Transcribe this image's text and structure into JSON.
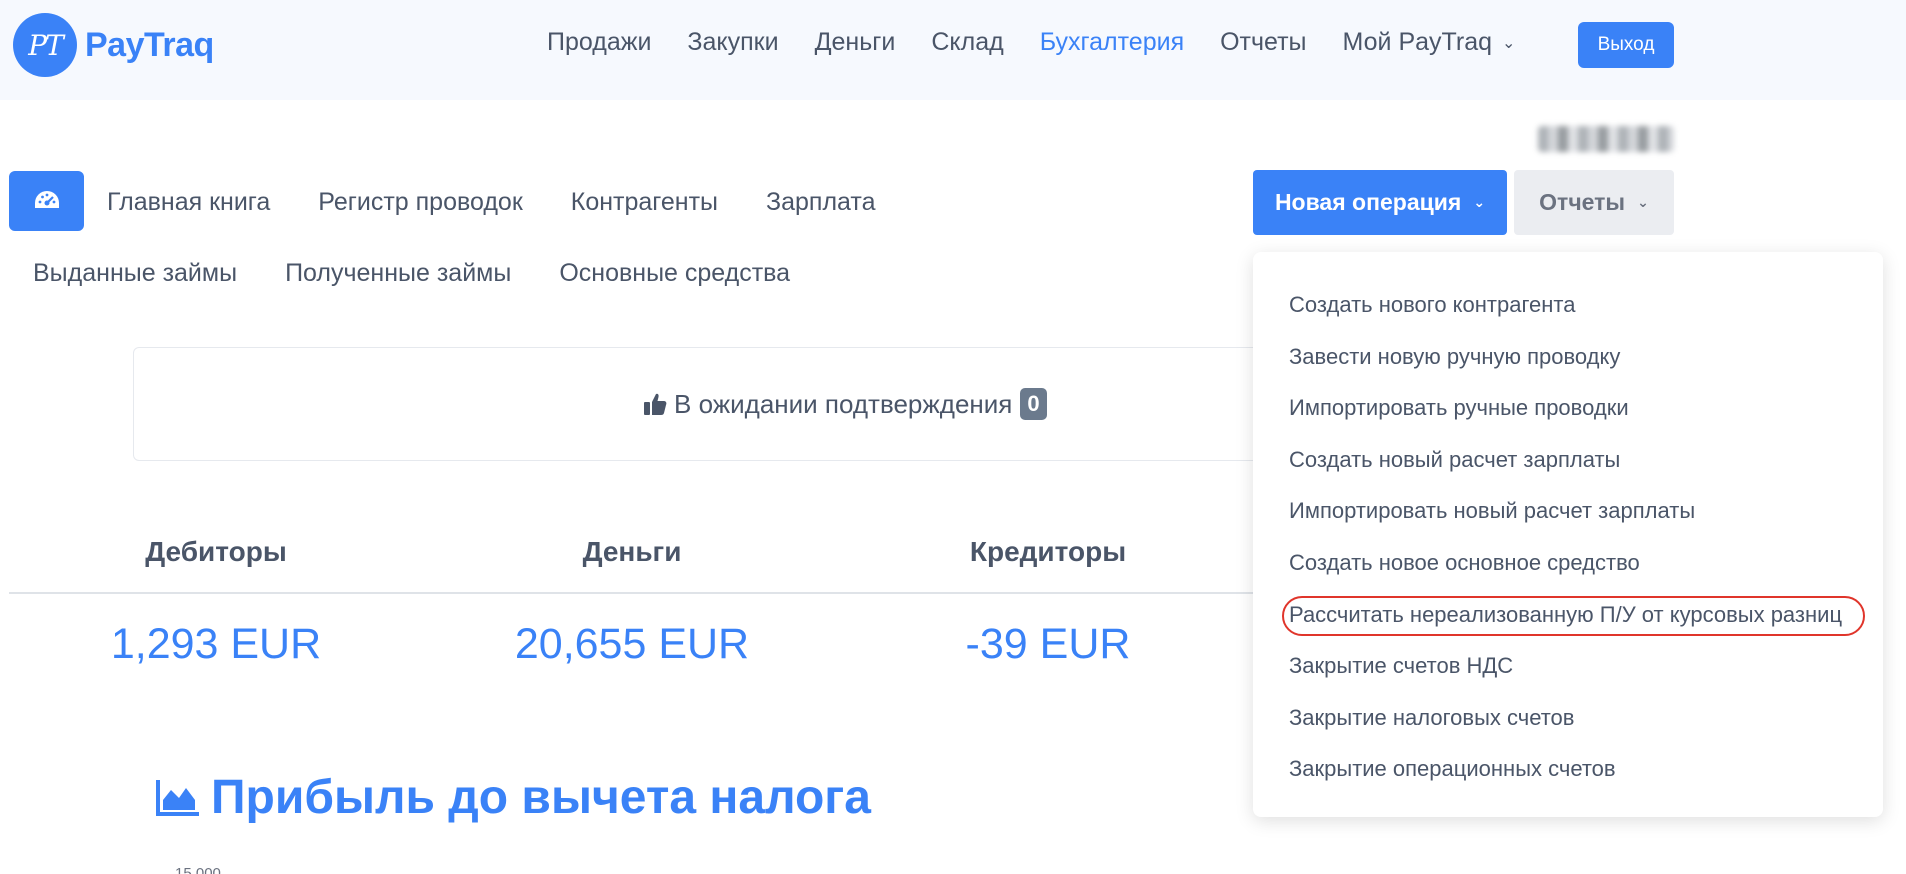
{
  "brand": {
    "name": "PayTraq",
    "logo_initials": "PT"
  },
  "main_nav": {
    "items": [
      {
        "label": "Продажи",
        "active": false
      },
      {
        "label": "Закупки",
        "active": false
      },
      {
        "label": "Деньги",
        "active": false
      },
      {
        "label": "Склад",
        "active": false
      },
      {
        "label": "Бухгалтерия",
        "active": true
      },
      {
        "label": "Отчеты",
        "active": false
      },
      {
        "label": "Мой PayTraq",
        "active": false,
        "has_dropdown": true
      }
    ],
    "logout_label": "Выход"
  },
  "sub_nav": {
    "dashboard_icon": "speedometer-icon",
    "row1": [
      "Главная книга",
      "Регистр проводок",
      "Контрагенты",
      "Зарплата"
    ],
    "row2": [
      "Выданные займы",
      "Полученные займы",
      "Основные средства"
    ]
  },
  "actions": {
    "new_operation_label": "Новая операция",
    "reports_label": "Отчеты"
  },
  "pending": {
    "icon": "thumbs-up-icon",
    "label": "В ожидании подтверждения",
    "count": "0"
  },
  "stats": [
    {
      "label": "Дебиторы",
      "value": "1,293 EUR"
    },
    {
      "label": "Деньги",
      "value": "20,655 EUR"
    },
    {
      "label": "Кредиторы",
      "value": "-39 EUR"
    }
  ],
  "chart": {
    "icon": "area-chart-icon",
    "title": "Прибыль до вычета налога",
    "first_tick": "15,000"
  },
  "dropdown": {
    "items": [
      "Создать нового контрагента",
      "Завести новую ручную проводку",
      "Импортировать ручные проводки",
      "Создать новый расчет зарплаты",
      "Импортировать новый расчет зарплаты",
      "Создать новое основное средство",
      "Рассчитать нереализованную П/У от курсовых разниц",
      "Закрытие счетов НДС",
      "Закрытие налоговых счетов",
      "Закрытие операционных счетов"
    ],
    "highlighted_index": 6,
    "highlight_color": "#e0352b"
  },
  "colors": {
    "accent": "#3a82f7",
    "text": "#4a5568",
    "navbar_bg": "#f6f9fe"
  }
}
